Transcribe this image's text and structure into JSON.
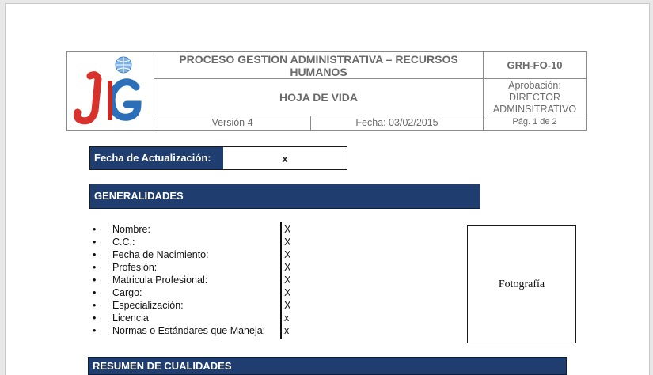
{
  "header": {
    "title": "PROCESO GESTION ADMINISTRATIVA – RECURSOS HUMANOS",
    "code": "GRH-FO-10",
    "document": "HOJA DE VIDA",
    "approval": "Aprobación: DIRECTOR ADMINSITRATIVO",
    "version": "Versión  4",
    "date": "Fecha: 03/02/2015",
    "page": "Pág. 1 de 2",
    "logo_text": "JG",
    "logo_colors": {
      "primary": "#d9312b",
      "secondary": "#2a6fb8"
    }
  },
  "update": {
    "label": "Fecha de Actualización:",
    "value": "x"
  },
  "sections": {
    "general": "GENERALIDADES",
    "summary": "RESUMEN DE CUALIDADES"
  },
  "fields": [
    {
      "label": "Nombre:",
      "value": "X"
    },
    {
      "label": "C.C.:",
      "value": "X"
    },
    {
      "label": "Fecha de Nacimiento:",
      "value": "X"
    },
    {
      "label": "Profesión:",
      "value": "X"
    },
    {
      "label": "Matricula Profesional:",
      "value": "X"
    },
    {
      "label": "Cargo:",
      "value": "X"
    },
    {
      "label": "Especialización:",
      "value": "X"
    },
    {
      "label": "Licencia",
      "value": "x"
    },
    {
      "label": "Normas o Estándares que Maneja:",
      "value": "x"
    }
  ],
  "photo_label": "Fotografía",
  "colors": {
    "section_bar": "#1f3d6e",
    "header_text": "#6a6a6a"
  }
}
